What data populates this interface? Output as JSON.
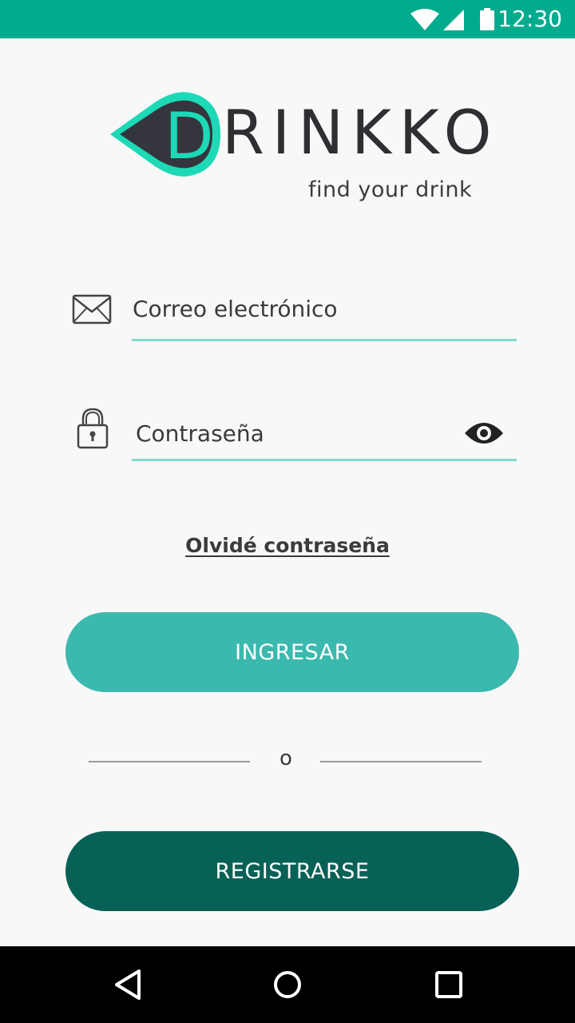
{
  "status_bar": {
    "time": "12:30",
    "icons": [
      "wifi-icon",
      "signal-icon",
      "battery-icon"
    ],
    "background_color": "#00ab8e"
  },
  "brand": {
    "logo_letter": "D",
    "name_rest": "RINKKO",
    "tagline": "find your drink",
    "accent_color": "#1dd9b6"
  },
  "form": {
    "email": {
      "placeholder": "Correo electrónico",
      "value": "",
      "icon": "envelope-icon"
    },
    "password": {
      "placeholder": "Contraseña",
      "value": "",
      "icon": "lock-icon",
      "toggle_icon": "eye-icon"
    },
    "underline_color": "#7fdccc"
  },
  "forgot_password_label": "Olvidé contraseña",
  "buttons": {
    "login_label": "INGRESAR",
    "login_color": "#3cb9ae",
    "divider_label": "o",
    "register_label": "REGISTRARSE",
    "register_color": "#086156"
  },
  "nav_bar": {
    "icons": [
      "back-icon",
      "home-icon",
      "recents-icon"
    ]
  }
}
